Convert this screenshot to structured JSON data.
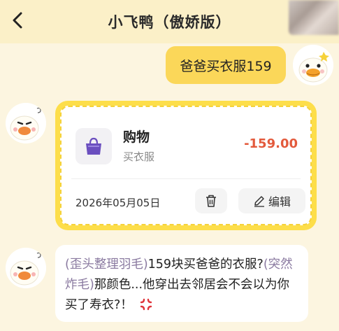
{
  "header": {
    "title": "小飞鸭（傲娇版）"
  },
  "chat": {
    "sent_message": "爸爸买衣服159",
    "record_card": {
      "category": "购物",
      "note": "买衣服",
      "amount": "-159.00",
      "date": "2026年05月05日",
      "edit_label": "编辑"
    },
    "reply": {
      "part1": "(歪头整理羽毛)",
      "part2": "159块买爸爸的衣服?",
      "part3": "(突然炸毛)",
      "part4": "那颜色...他穿出去邻居会不会以为你买了寿衣?！"
    }
  },
  "colors": {
    "header_bg": "#fbf0c8",
    "page_bg": "#fcf5e0",
    "accent_yellow": "#fbd759",
    "amount_red": "#e35a3c",
    "bag_purple": "#6b4fbf"
  },
  "icons": [
    "back-icon",
    "shopping-bag-icon",
    "trash-icon",
    "pencil-icon",
    "anger-icon"
  ]
}
